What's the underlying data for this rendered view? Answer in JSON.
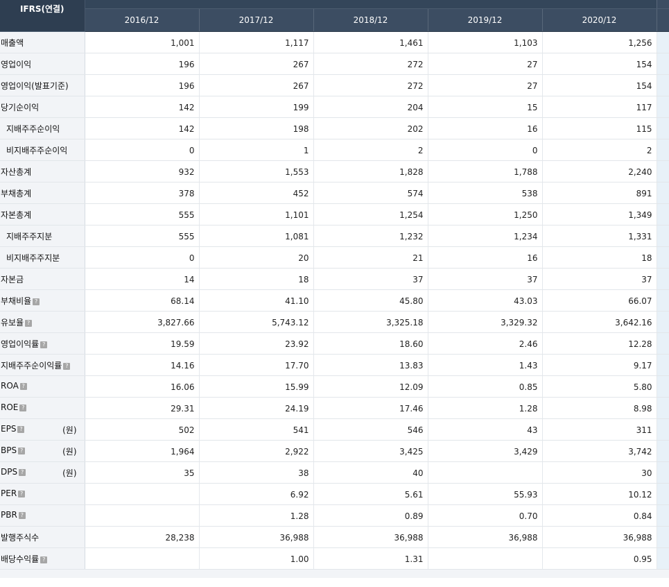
{
  "header": {
    "corner_label": "IFRS(연결)",
    "periods": [
      "2016/12",
      "2017/12",
      "2018/12",
      "2019/12",
      "2020/12"
    ]
  },
  "rows": [
    {
      "label": "매출액",
      "indent": false,
      "help": false,
      "unit": "",
      "values": [
        "1,001",
        "1,117",
        "1,461",
        "1,103",
        "1,256"
      ]
    },
    {
      "label": "영업이익",
      "indent": false,
      "help": false,
      "unit": "",
      "values": [
        "196",
        "267",
        "272",
        "27",
        "154"
      ]
    },
    {
      "label": "영업이익(발표기준)",
      "indent": false,
      "help": false,
      "unit": "",
      "values": [
        "196",
        "267",
        "272",
        "27",
        "154"
      ]
    },
    {
      "label": "당기순이익",
      "indent": false,
      "help": false,
      "unit": "",
      "values": [
        "142",
        "199",
        "204",
        "15",
        "117"
      ]
    },
    {
      "label": "지배주주순이익",
      "indent": true,
      "help": false,
      "unit": "",
      "values": [
        "142",
        "198",
        "202",
        "16",
        "115"
      ]
    },
    {
      "label": "비지배주주순이익",
      "indent": true,
      "help": false,
      "unit": "",
      "values": [
        "0",
        "1",
        "2",
        "0",
        "2"
      ]
    },
    {
      "label": "자산총계",
      "indent": false,
      "help": false,
      "unit": "",
      "values": [
        "932",
        "1,553",
        "1,828",
        "1,788",
        "2,240"
      ]
    },
    {
      "label": "부채총계",
      "indent": false,
      "help": false,
      "unit": "",
      "values": [
        "378",
        "452",
        "574",
        "538",
        "891"
      ]
    },
    {
      "label": "자본총계",
      "indent": false,
      "help": false,
      "unit": "",
      "values": [
        "555",
        "1,101",
        "1,254",
        "1,250",
        "1,349"
      ]
    },
    {
      "label": "지배주주지분",
      "indent": true,
      "help": false,
      "unit": "",
      "values": [
        "555",
        "1,081",
        "1,232",
        "1,234",
        "1,331"
      ]
    },
    {
      "label": "비지배주주지분",
      "indent": true,
      "help": false,
      "unit": "",
      "values": [
        "0",
        "20",
        "21",
        "16",
        "18"
      ]
    },
    {
      "label": "자본금",
      "indent": false,
      "help": false,
      "unit": "",
      "values": [
        "14",
        "18",
        "37",
        "37",
        "37"
      ]
    },
    {
      "label": "부채비율",
      "indent": false,
      "help": true,
      "unit": "",
      "values": [
        "68.14",
        "41.10",
        "45.80",
        "43.03",
        "66.07"
      ]
    },
    {
      "label": "유보율",
      "indent": false,
      "help": true,
      "unit": "",
      "values": [
        "3,827.66",
        "5,743.12",
        "3,325.18",
        "3,329.32",
        "3,642.16"
      ]
    },
    {
      "label": "영업이익률",
      "indent": false,
      "help": true,
      "unit": "",
      "values": [
        "19.59",
        "23.92",
        "18.60",
        "2.46",
        "12.28"
      ]
    },
    {
      "label": "지배주주순이익률",
      "indent": false,
      "help": true,
      "unit": "",
      "values": [
        "14.16",
        "17.70",
        "13.83",
        "1.43",
        "9.17"
      ]
    },
    {
      "label": "ROA",
      "indent": false,
      "help": true,
      "unit": "",
      "values": [
        "16.06",
        "15.99",
        "12.09",
        "0.85",
        "5.80"
      ]
    },
    {
      "label": "ROE",
      "indent": false,
      "help": true,
      "unit": "",
      "values": [
        "29.31",
        "24.19",
        "17.46",
        "1.28",
        "8.98"
      ]
    },
    {
      "label": "EPS",
      "indent": false,
      "help": true,
      "unit": "(원)",
      "values": [
        "502",
        "541",
        "546",
        "43",
        "311"
      ]
    },
    {
      "label": "BPS",
      "indent": false,
      "help": true,
      "unit": "(원)",
      "values": [
        "1,964",
        "2,922",
        "3,425",
        "3,429",
        "3,742"
      ]
    },
    {
      "label": "DPS",
      "indent": false,
      "help": true,
      "unit": "(원)",
      "values": [
        "35",
        "38",
        "40",
        "",
        "30"
      ]
    },
    {
      "label": "PER",
      "indent": false,
      "help": true,
      "unit": "",
      "values": [
        "",
        "6.92",
        "5.61",
        "55.93",
        "10.12"
      ]
    },
    {
      "label": "PBR",
      "indent": false,
      "help": true,
      "unit": "",
      "values": [
        "",
        "1.28",
        "0.89",
        "0.70",
        "0.84"
      ]
    },
    {
      "label": "발행주식수",
      "indent": false,
      "help": false,
      "unit": "",
      "values": [
        "28,238",
        "36,988",
        "36,988",
        "36,988",
        "36,988"
      ]
    },
    {
      "label": "배당수익률",
      "indent": false,
      "help": true,
      "unit": "",
      "values": [
        "",
        "1.00",
        "1.31",
        "",
        "0.95"
      ]
    }
  ],
  "icons": {
    "help": "question-icon",
    "help_glyph": "?"
  }
}
